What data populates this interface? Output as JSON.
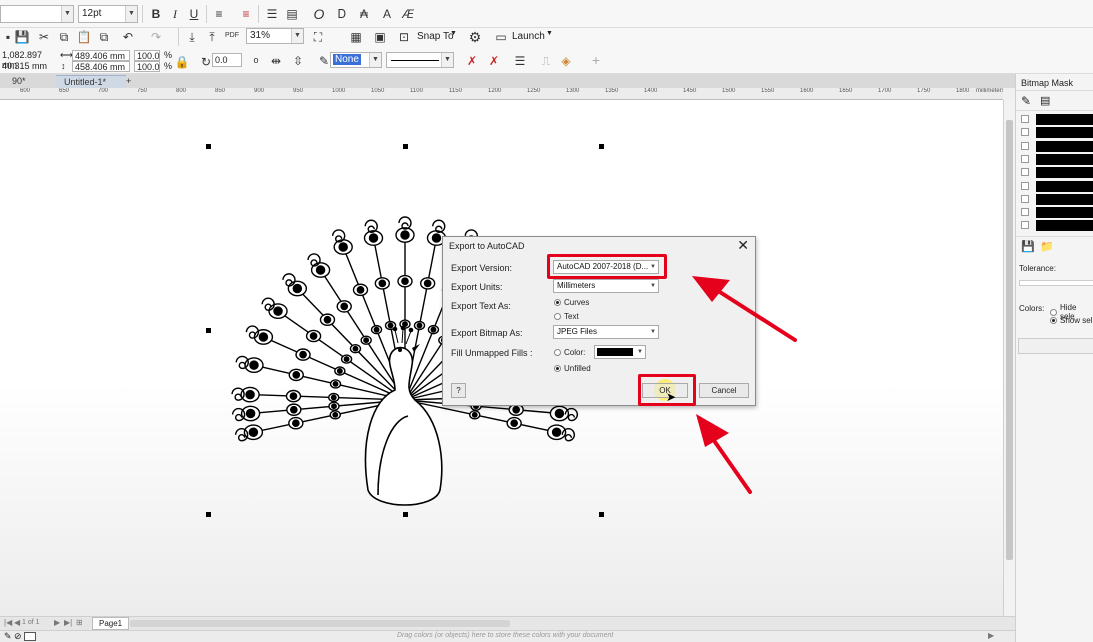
{
  "toolbar": {
    "font_size": "12pt",
    "zoom": "31%",
    "snap_to": "Snap To",
    "launch": "Launch",
    "pos_x": "1,082.897 mm",
    "pos_y": "40.315 mm",
    "width": "489.406 mm",
    "height": "458.406 mm",
    "scale_x": "100.0",
    "scale_y": "100.0",
    "pct": "%",
    "rotation": "0.0",
    "outline_fill": "None",
    "icons": [
      "save-icon",
      "bold-icon",
      "italic-icon",
      "underline-icon",
      "undo-icon",
      "redo-icon",
      "import-icon",
      "export-icon",
      "pdf-icon",
      "settings-icon",
      "launch-icon"
    ]
  },
  "tabs": [
    {
      "label": "90*",
      "active": false
    },
    {
      "label": "Untitled-1*",
      "active": true
    },
    {
      "label": "+",
      "active": false
    }
  ],
  "ruler": {
    "ticks": [
      "600",
      "650",
      "700",
      "750",
      "800",
      "850",
      "900",
      "950",
      "1000",
      "1050",
      "1100",
      "1150",
      "1200",
      "1250",
      "1300",
      "1350",
      "1400",
      "1450",
      "1500",
      "1550",
      "1600",
      "1650",
      "1700",
      "1750",
      "1800"
    ],
    "unit": "millimeters"
  },
  "dialog": {
    "title": "Export to AutoCAD",
    "export_version_label": "Export Version:",
    "export_version_value": "AutoCAD 2007-2018 (D...",
    "export_units_label": "Export Units:",
    "export_units_value": "Millimeters",
    "export_text_label": "Export Text As:",
    "text_opt_curves": "Curves",
    "text_opt_text": "Text",
    "export_bitmap_label": "Export Bitmap As:",
    "export_bitmap_value": "JPEG Files",
    "fill_label": "Fill Unmapped Fills :",
    "fill_opt_color": "Color:",
    "fill_opt_unfilled": "Unfilled",
    "help_label": "?",
    "ok_label": "OK",
    "cancel_label": "Cancel",
    "swatch_color": "#000000"
  },
  "docker": {
    "title": "Bitmap Mask",
    "tolerance_label": "Tolerance:",
    "colors_label": "Colors:",
    "hide_label": "Hide sele",
    "show_label": "Show sel",
    "swatch_count": 9
  },
  "pagebar": {
    "page_of": "1 of 1",
    "page_label": "Page1"
  },
  "status": {
    "hint": "Drag colors (or objects) here to store these colors with your document"
  },
  "accent": "#e5001b"
}
